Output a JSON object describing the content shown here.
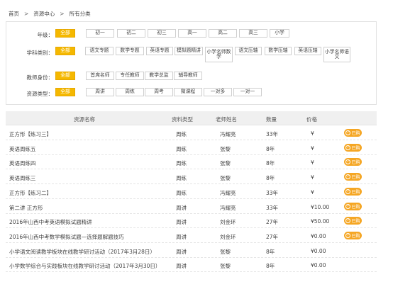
{
  "breadcrumb": [
    "首页",
    "资源中心",
    "所有分类"
  ],
  "filters": {
    "grade": {
      "label": "年级：",
      "options": [
        "全部",
        "初一",
        "初二",
        "初三",
        "高一",
        "高二",
        "高三",
        "小学"
      ]
    },
    "subject": {
      "label": "学科类别：",
      "options": [
        "全部",
        "语文专题",
        "数学专题",
        "英语专题",
        "模拟题精讲",
        "小学名师数学",
        "语文压轴",
        "数学压轴",
        "英语压轴",
        "小学名师语文"
      ]
    },
    "teacher": {
      "label": "教师身份：",
      "options": [
        "全部",
        "首席名师",
        "专任教师",
        "教学总监",
        "辅导教师"
      ]
    },
    "type": {
      "label": "资源类型：",
      "options": [
        "全部",
        "周讲",
        "周练",
        "周考",
        "微课程",
        "一对多",
        "一对一"
      ]
    }
  },
  "table": {
    "headers": [
      "资源名称",
      "资料类型",
      "老师姓名",
      "数量",
      "价格"
    ],
    "buy_label": "已购",
    "rows": [
      {
        "name": "正方形【练习三】",
        "type": "周练",
        "teacher": "冯耀亮",
        "count": "33年",
        "price": "¥"
      },
      {
        "name": "英语周练五",
        "type": "周练",
        "teacher": "张黎",
        "count": "8年",
        "price": "¥"
      },
      {
        "name": "英语周练四",
        "type": "周练",
        "teacher": "张黎",
        "count": "8年",
        "price": "¥"
      },
      {
        "name": "英语周练三",
        "type": "周练",
        "teacher": "张黎",
        "count": "8年",
        "price": "¥"
      },
      {
        "name": "正方形【练习二】",
        "type": "周练",
        "teacher": "冯耀亮",
        "count": "33年",
        "price": "¥"
      },
      {
        "name": "第二讲 正方形",
        "type": "周讲",
        "teacher": "冯耀亮",
        "count": "33年",
        "price": "¥10.00"
      },
      {
        "name": "2016年山西中考英语模拟试题精讲",
        "type": "周讲",
        "teacher": "刘金环",
        "count": "27年",
        "price": "¥50.00"
      },
      {
        "name": "2016年山西中考数学模拟试题—选择题解题技巧",
        "type": "周讲",
        "teacher": "刘金环",
        "count": "27年",
        "price": "¥0.00"
      },
      {
        "name": "小学语文阅读教学板块在线教学研讨活动（2017年3月28日）",
        "type": "周讲",
        "teacher": "张黎",
        "count": "8年",
        "price": "¥0.00"
      },
      {
        "name": "小学数学综合与实践板块在线教学研讨活动（2017年3月30日）",
        "type": "周讲",
        "teacher": "张黎",
        "count": "8年",
        "price": "¥0.00"
      }
    ]
  },
  "colors": {
    "accent": "#f5b800",
    "buy": "#f5a623"
  }
}
